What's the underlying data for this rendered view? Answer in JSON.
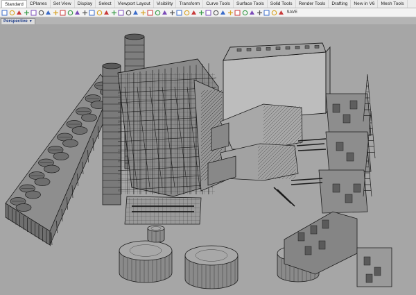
{
  "tabs": [
    "Standard",
    "CPlanes",
    "Set View",
    "Display",
    "Select",
    "Viewport Layout",
    "Visibility",
    "Transform",
    "Curve Tools",
    "Surface Tools",
    "Solid Tools",
    "Render Tools",
    "Drafting",
    "New in V6",
    "Mesh Tools"
  ],
  "active_tab": "Standard",
  "toolbar": {
    "icons": [
      "new-file-icon",
      "open-icon",
      "save-icon",
      "print-icon",
      "import-icon",
      "cut-icon",
      "copy-icon",
      "paste-icon",
      "undo-icon",
      "redo-icon",
      "pan-icon",
      "rotate-view-icon",
      "zoom-icon",
      "zoom-window-icon",
      "zoom-extents-icon",
      "zoom-selected-icon",
      "select-icon",
      "move-icon",
      "copy-object-icon",
      "grid-icon",
      "layer-icon",
      "properties-icon",
      "shade-icon",
      "render-icon",
      "light-icon",
      "lock-icon",
      "hide-icon",
      "show-icon",
      "color-wheel-icon",
      "material-icon",
      "rendered-icon",
      "point-icon",
      "analyze-icon",
      "light-bulb-icon",
      "options-icon",
      "help-icon",
      "display-mode-icon",
      "named-view-icon",
      "snapshot-icon"
    ],
    "save_label": "SAVE"
  },
  "viewport": {
    "title": "Perspective",
    "dropdown_glyph": "▼",
    "background_color": "#a6a6a6",
    "model_fill": "#8d8d8d",
    "wire_color": "#1e1e1e"
  }
}
